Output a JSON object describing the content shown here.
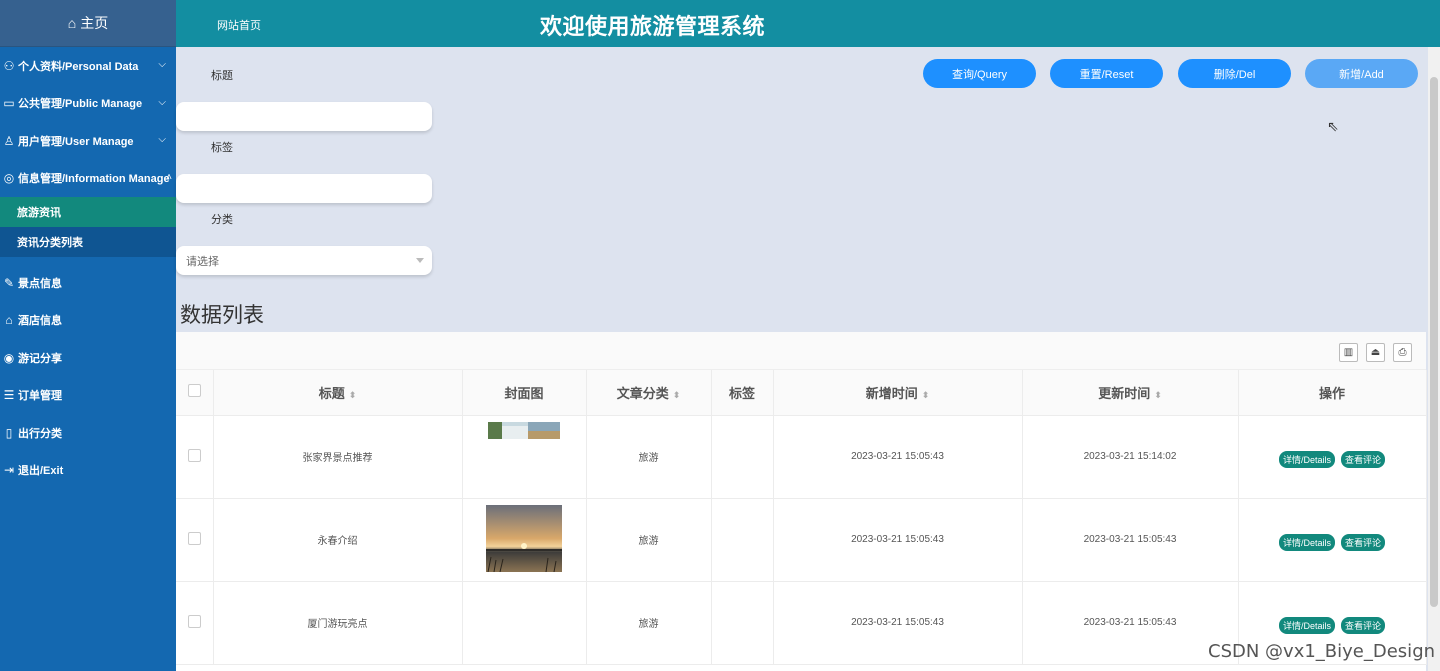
{
  "sidebar": {
    "home": "主页",
    "items": [
      {
        "label": "个人资料/Personal Data",
        "icon": "user-profile-icon",
        "glyph": "⚇",
        "chevron": true
      },
      {
        "label": "公共管理/Public Manage",
        "icon": "monitor-icon",
        "glyph": "▭",
        "chevron": true
      },
      {
        "label": "用户管理/User Manage",
        "icon": "user-icon",
        "glyph": "♙",
        "chevron": true
      },
      {
        "label": "信息管理/Information Manage",
        "icon": "info-icon",
        "glyph": "◎",
        "chevron": true
      }
    ],
    "sub_items": [
      "旅游资讯",
      "资讯分类列表"
    ],
    "items2": [
      {
        "label": "景点信息",
        "icon": "scenic-icon",
        "glyph": "✎"
      },
      {
        "label": "酒店信息",
        "icon": "hotel-icon",
        "glyph": "⌂"
      },
      {
        "label": "游记分享",
        "icon": "share-icon",
        "glyph": "◉"
      },
      {
        "label": "订单管理",
        "icon": "order-icon",
        "glyph": "☰"
      },
      {
        "label": "出行分类",
        "icon": "category-icon",
        "glyph": "▯"
      },
      {
        "label": "退出/Exit",
        "icon": "exit-icon",
        "glyph": "⇥"
      }
    ]
  },
  "header": {
    "home_link": "网站首页",
    "title": "欢迎使用旅游管理系统"
  },
  "search": {
    "title_label": "标题",
    "tag_label": "标签",
    "category_label": "分类",
    "category_placeholder": "请选择"
  },
  "buttons": {
    "query": "查询/Query",
    "reset": "重置/Reset",
    "delete": "删除/Del",
    "add": "新增/Add"
  },
  "section_title": "数据列表",
  "table": {
    "headers": [
      "标题",
      "封面图",
      "文章分类",
      "标签",
      "新增时间",
      "更新时间",
      "操作"
    ],
    "rows": [
      {
        "title": "张家界景点推荐",
        "category": "旅游",
        "tag": "",
        "created": "2023-03-21 15:05:43",
        "updated": "2023-03-21 15:14:02"
      },
      {
        "title": "永春介绍",
        "category": "旅游",
        "tag": "",
        "created": "2023-03-21 15:05:43",
        "updated": "2023-03-21 15:05:43"
      },
      {
        "title": "厦门游玩亮点",
        "category": "旅游",
        "tag": "",
        "created": "2023-03-21 15:05:43",
        "updated": "2023-03-21 15:05:43"
      }
    ],
    "op_details": "详情/Details",
    "op_comments": "查看评论"
  },
  "watermark": "CSDN @vx1_Biye_Design"
}
